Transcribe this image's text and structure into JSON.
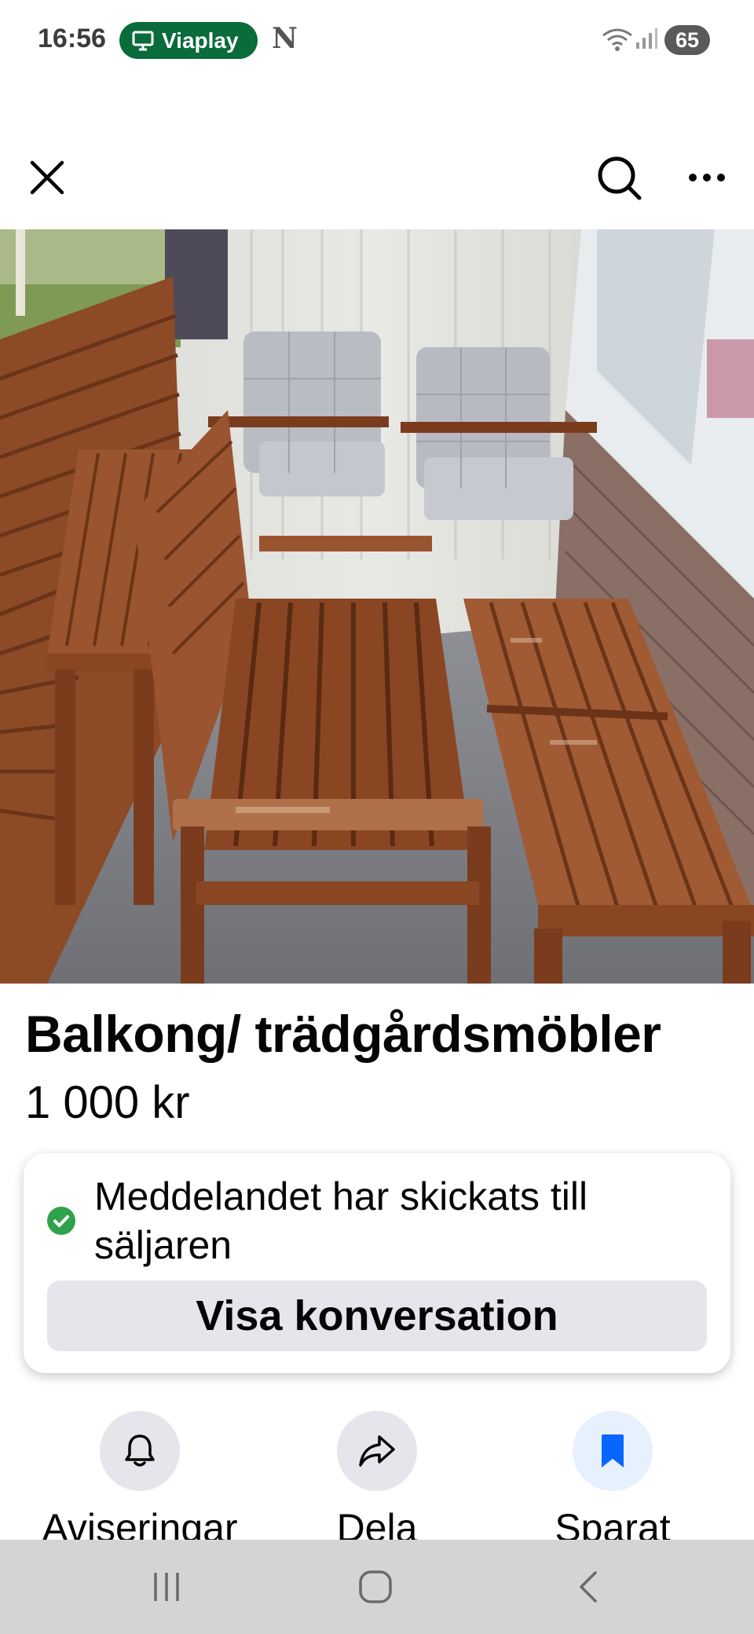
{
  "status_bar": {
    "time": "16:56",
    "app_pill": "Viaplay",
    "battery": "65",
    "icons": [
      "tv-icon",
      "netflix-n-icon",
      "wifi-icon",
      "signal-icon",
      "battery-icon"
    ]
  },
  "top_bar": {
    "icons": [
      "close-icon",
      "search-icon",
      "more-icon"
    ]
  },
  "listing": {
    "title": "Balkong/ trädgårdsmöbler",
    "price": "1 000 kr"
  },
  "message_card": {
    "status_text": "Meddelandet har skickats till säljaren",
    "button_label": "Visa konversation",
    "status_color": "#31a24c"
  },
  "actions": [
    {
      "label": "Aviseringar",
      "icon": "bell-icon"
    },
    {
      "label": "Dela",
      "icon": "share-icon"
    },
    {
      "label": "Sparat",
      "icon": "bookmark-icon"
    }
  ],
  "nav_bar": {
    "icons": [
      "recent-apps-icon",
      "home-icon",
      "back-icon"
    ]
  },
  "colors": {
    "accent": "#0866ff",
    "button_bg": "#e4e6eb",
    "nav_bg": "#d3d4d6"
  }
}
